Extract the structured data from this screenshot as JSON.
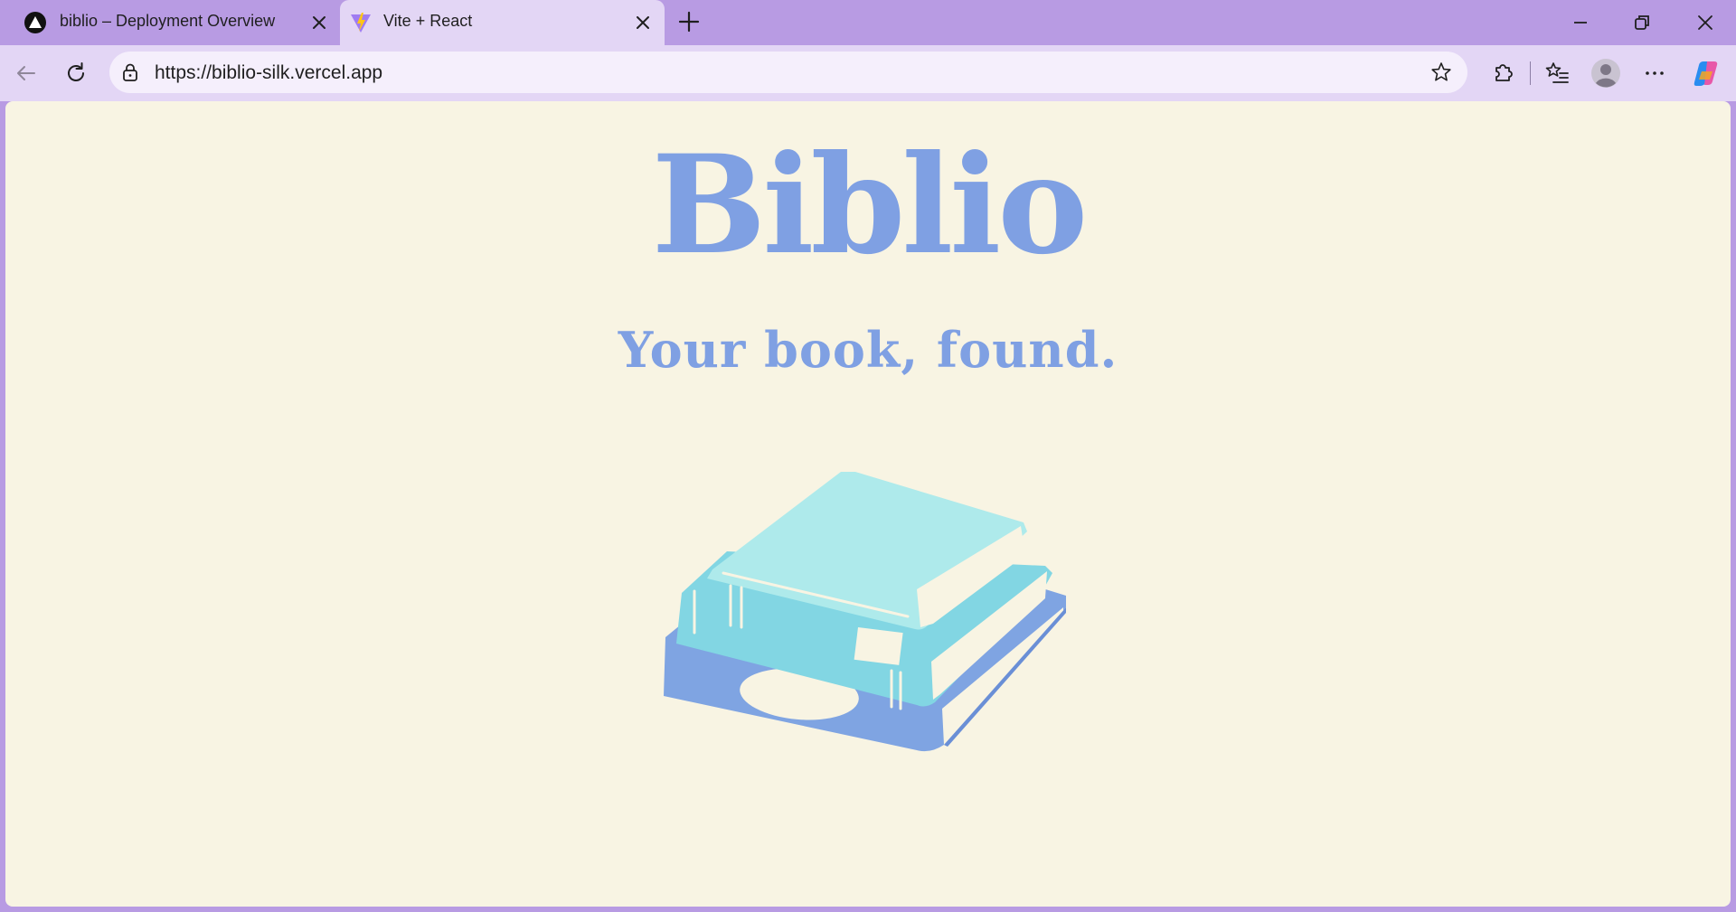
{
  "tabs": [
    {
      "title": "biblio – Deployment Overview",
      "favicon": "vercel-triangle-icon",
      "active": false
    },
    {
      "title": "Vite + React",
      "favicon": "vite-logo-icon",
      "active": true
    }
  ],
  "toolbar": {
    "url": "https://biblio-silk.vercel.app"
  },
  "page": {
    "title": "Biblio",
    "subtitle": "Your book, found.",
    "illustration": "stacked-books-illustration"
  },
  "colors": {
    "browser_frame": "#b89be3",
    "toolbar": "#e3d6f5",
    "page_background": "#f8f4e3",
    "brand_text": "#7fa0e3",
    "book_top": "#aeeaeb",
    "book_middle": "#82d6e3",
    "book_bottom": "#7fa4e2",
    "pages": "#f8f4e3"
  }
}
